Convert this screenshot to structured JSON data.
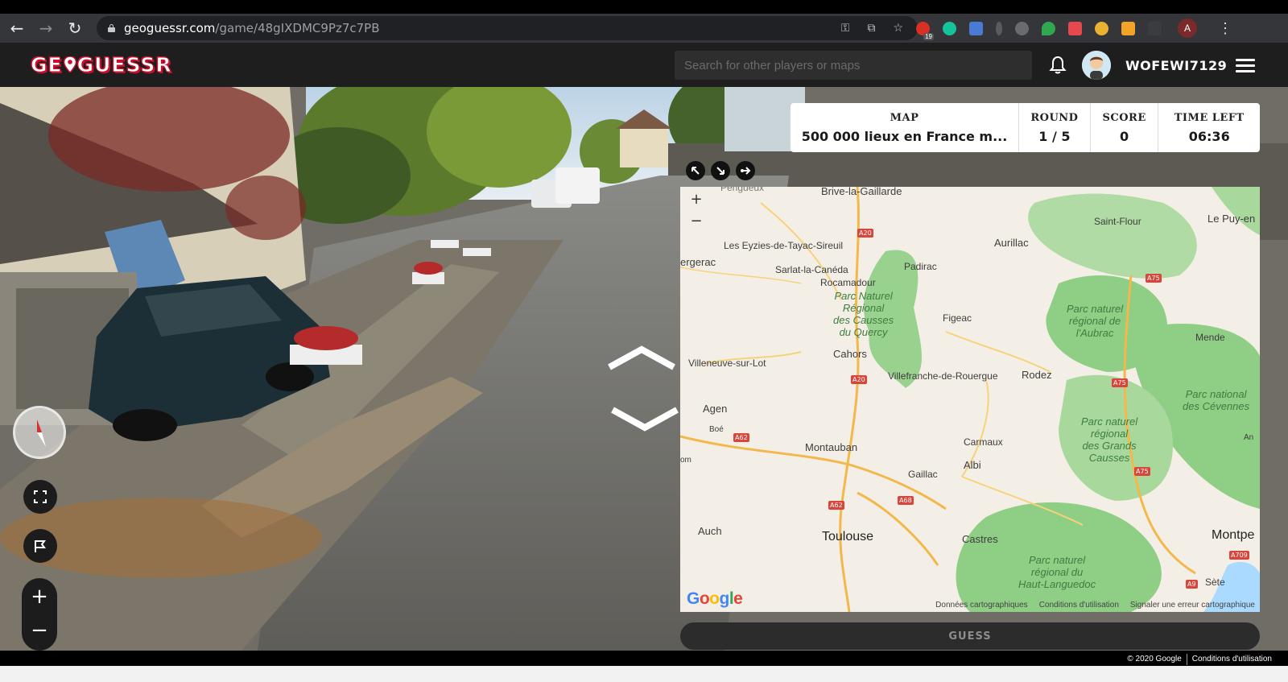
{
  "browser": {
    "url_host": "geoguessr.com",
    "url_path": "/game/48gIXDMC9Pz7c7PB",
    "extension_badge": "19",
    "profile_initial": "A",
    "icons": [
      "back-icon",
      "forward-icon",
      "reload-icon",
      "lock-icon",
      "key-icon",
      "translate-icon",
      "star-icon",
      "menu-kebab-icon"
    ]
  },
  "header": {
    "logo_left": "GE",
    "logo_right": "GUESSR",
    "search_placeholder": "Search for other players or maps",
    "username": "WOFEWI7129"
  },
  "status": {
    "map_label": "MAP",
    "map_value": "500 000 lieux en France m...",
    "round_label": "ROUND",
    "round_value": "1 / 5",
    "score_label": "SCORE",
    "score_value": "0",
    "time_label": "TIME LEFT",
    "time_value": "06:36"
  },
  "map": {
    "cities": {
      "brive": "Brive-la-Gaillarde",
      "saintflour": "Saint-Flour",
      "lepuy": "Le Puy-en",
      "eyzies": "Les Eyzies-de-Tayac-Sireuil",
      "aurillac": "Aurillac",
      "bergerac": "ergerac",
      "sarlat": "Sarlat-la-Canéda",
      "padirac": "Padirac",
      "rocamadour": "Rocamadour",
      "figeac": "Figeac",
      "mende": "Mende",
      "cahors": "Cahors",
      "villeneuve": "Villeneuve-sur-Lot",
      "villefranche": "Villefranche-de-Rouergue",
      "rodez": "Rodez",
      "agen": "Agen",
      "boe": "Boé",
      "montauban": "Montauban",
      "carmaux": "Carmaux",
      "albi": "Albi",
      "gaillac": "Gaillac",
      "om": "om",
      "auch": "Auch",
      "toulouse": "Toulouse",
      "castres": "Castres",
      "montpe": "Montpe",
      "sete": "Sète",
      "perigueux": "Périgueux",
      "an": "An"
    },
    "parks": {
      "causses_quercy": [
        "Parc Naturel",
        "Régional",
        "des Causses",
        "du Quercy"
      ],
      "aubrac": [
        "Parc naturel",
        "régional de",
        "l'Aubrac"
      ],
      "cevennes": [
        "Parc national",
        "des Cévennes"
      ],
      "grands_causses": [
        "Parc naturel",
        "régional",
        "des Grands",
        "Causses"
      ],
      "haut_languedoc": [
        "Parc naturel",
        "régional du",
        "Haut-Languedoc"
      ]
    },
    "roads": {
      "a20a": "A20",
      "a20b": "A20",
      "a75a": "A75",
      "a75b": "A75",
      "a75c": "A75",
      "a62a": "A62",
      "a62b": "A62",
      "a68": "A68",
      "a709": "A709",
      "a9": "A9"
    },
    "zoom_in": "+",
    "zoom_out": "−",
    "google": [
      "G",
      "o",
      "o",
      "g",
      "l",
      "e"
    ],
    "attribution": [
      "Données cartographiques",
      "Conditions d'utilisation",
      "Signaler une erreur cartographique"
    ]
  },
  "guess_label": "GUESS",
  "footer": [
    "© 2020 Google",
    "Conditions d'utilisation"
  ],
  "controls": {
    "zoom_in": "+",
    "zoom_out": "−"
  },
  "colors": {
    "logo_red": "#c8102e",
    "header_bg": "#1e1e1e",
    "map_land": "#f4efe6",
    "map_park": "#8fce85",
    "guess_bg": "#2c2c2c"
  }
}
